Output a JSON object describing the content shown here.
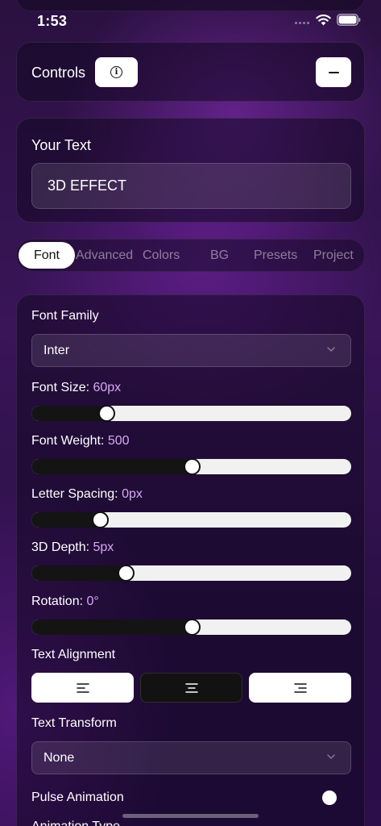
{
  "status_bar": {
    "time": "1:53"
  },
  "controls": {
    "title": "Controls"
  },
  "text_panel": {
    "title": "Your Text",
    "value": "3D EFFECT"
  },
  "tabs": [
    {
      "label": "Font",
      "active": true
    },
    {
      "label": "Advanced",
      "active": false
    },
    {
      "label": "Colors",
      "active": false
    },
    {
      "label": "BG",
      "active": false
    },
    {
      "label": "Presets",
      "active": false
    },
    {
      "label": "Project",
      "active": false
    }
  ],
  "font_panel": {
    "font_family": {
      "label": "Font Family",
      "value": "Inter"
    },
    "font_size": {
      "label": "Font Size: ",
      "value": "60px",
      "level": 0.235
    },
    "font_weight": {
      "label": "Font Weight: ",
      "value": "500",
      "level": 0.5
    },
    "letter_spacing": {
      "label": "Letter Spacing: ",
      "value": "0px",
      "level": 0.215
    },
    "depth": {
      "label": "3D Depth: ",
      "value": "5px",
      "level": 0.295
    },
    "rotation": {
      "label": "Rotation: ",
      "value": "0°",
      "level": 0.5
    },
    "text_alignment": {
      "label": "Text Alignment",
      "options": [
        "left",
        "center",
        "right"
      ],
      "selected": "center"
    },
    "text_transform": {
      "label": "Text Transform",
      "value": "None"
    },
    "pulse_animation": {
      "label": "Pulse Animation",
      "enabled": false
    },
    "animation_type": {
      "label": "Animation Type"
    }
  },
  "colors": {
    "value_accent": "#d7a8f4",
    "slider_fill": "#141414",
    "slider_track": "#f1f1f1"
  }
}
